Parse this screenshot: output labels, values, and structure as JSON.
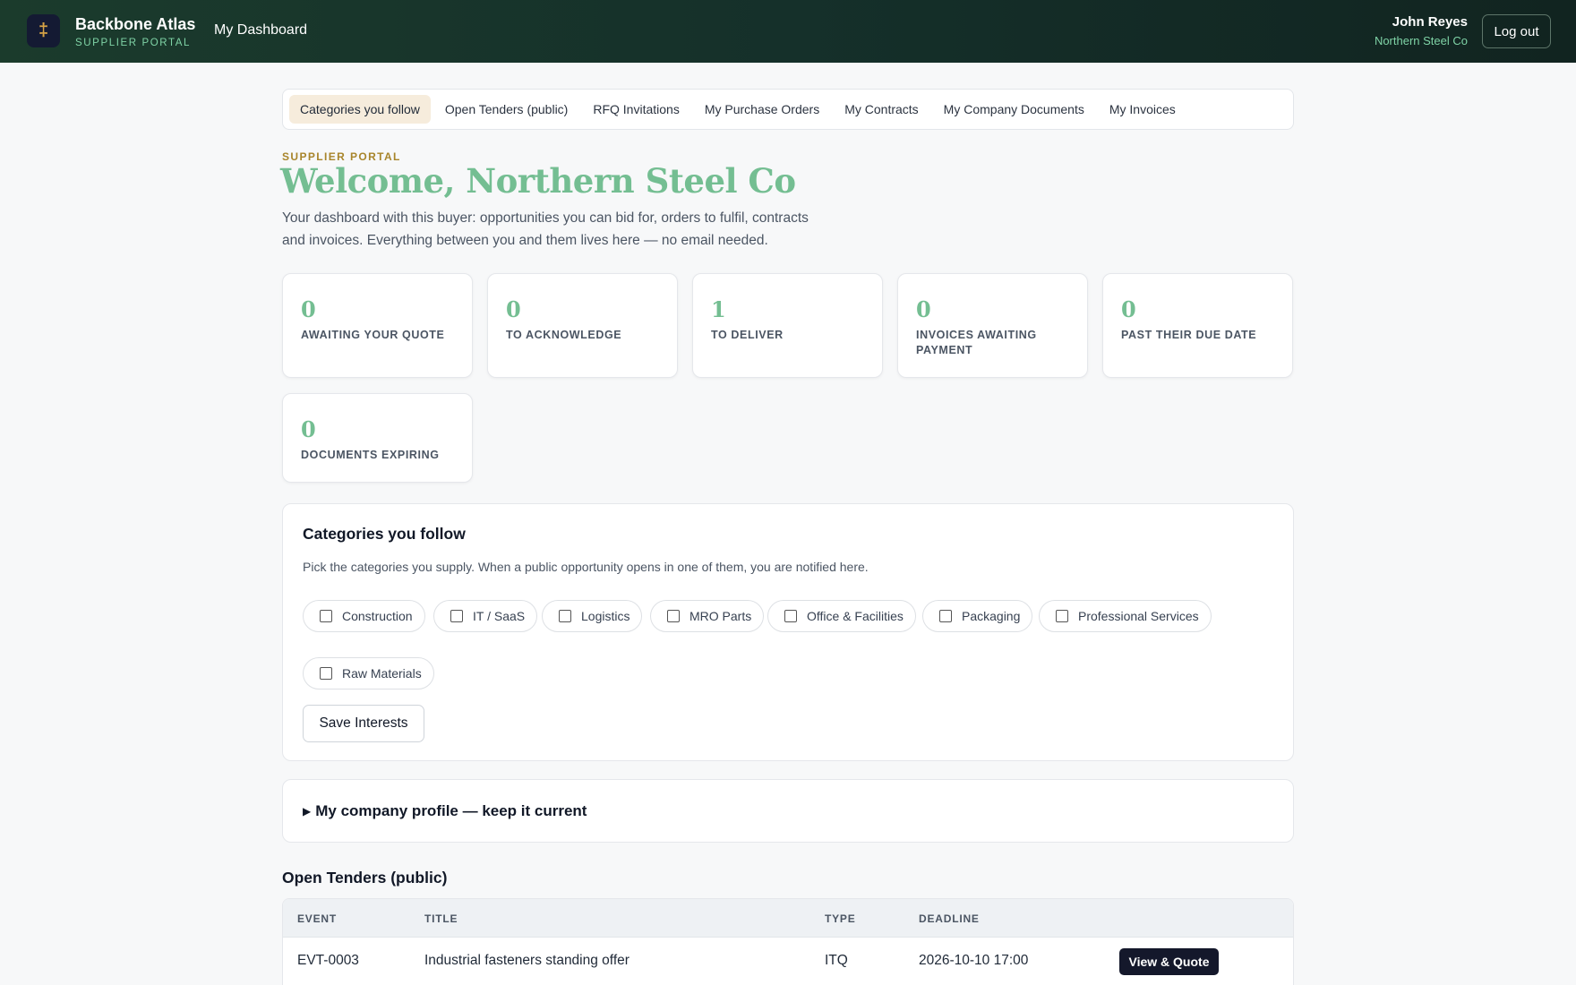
{
  "header": {
    "logo_glyph": "‡",
    "brand_name": "Backbone Atlas",
    "brand_sub": "SUPPLIER PORTAL",
    "nav_link": "My Dashboard",
    "user_name": "John Reyes",
    "user_company": "Northern Steel Co",
    "logout_label": "Log out"
  },
  "tabs": [
    {
      "label": "Categories you follow",
      "active": true
    },
    {
      "label": "Open Tenders (public)",
      "active": false
    },
    {
      "label": "RFQ Invitations",
      "active": false
    },
    {
      "label": "My Purchase Orders",
      "active": false
    },
    {
      "label": "My Contracts",
      "active": false
    },
    {
      "label": "My Company Documents",
      "active": false
    },
    {
      "label": "My Invoices",
      "active": false
    }
  ],
  "intro": {
    "eyebrow": "SUPPLIER PORTAL",
    "title": "Welcome, Northern Steel Co",
    "description": "Your dashboard with this buyer: opportunities you can bid for, orders to fulfil, contracts and invoices. Everything between you and them lives here — no email needed."
  },
  "stats": [
    {
      "value": "0",
      "label": "AWAITING YOUR QUOTE"
    },
    {
      "value": "0",
      "label": "TO ACKNOWLEDGE"
    },
    {
      "value": "1",
      "label": "TO DELIVER"
    },
    {
      "value": "0",
      "label": "INVOICES AWAITING PAYMENT"
    },
    {
      "value": "0",
      "label": "PAST THEIR DUE DATE"
    },
    {
      "value": "0",
      "label": "DOCUMENTS EXPIRING"
    }
  ],
  "categories": {
    "title": "Categories you follow",
    "description": "Pick the categories you supply. When a public opportunity opens in one of them, you are notified here.",
    "items": [
      {
        "label": "Construction",
        "checked": false
      },
      {
        "label": "IT / SaaS",
        "checked": false
      },
      {
        "label": "Logistics",
        "checked": false
      },
      {
        "label": "MRO Parts",
        "checked": false
      },
      {
        "label": "Office & Facilities",
        "checked": false
      },
      {
        "label": "Packaging",
        "checked": false
      },
      {
        "label": "Professional Services",
        "checked": false
      },
      {
        "label": "Raw Materials",
        "checked": false
      }
    ],
    "save_label": "Save Interests"
  },
  "profile": {
    "title": "My company profile — keep it current"
  },
  "tenders": {
    "title": "Open Tenders (public)",
    "columns": [
      "EVENT",
      "TITLE",
      "TYPE",
      "DEADLINE"
    ],
    "rows": [
      {
        "event": "EVT-0003",
        "title": "Industrial fasteners standing offer",
        "type": "ITQ",
        "deadline": "2026-10-10 17:00",
        "action": "View & Quote"
      }
    ]
  }
}
